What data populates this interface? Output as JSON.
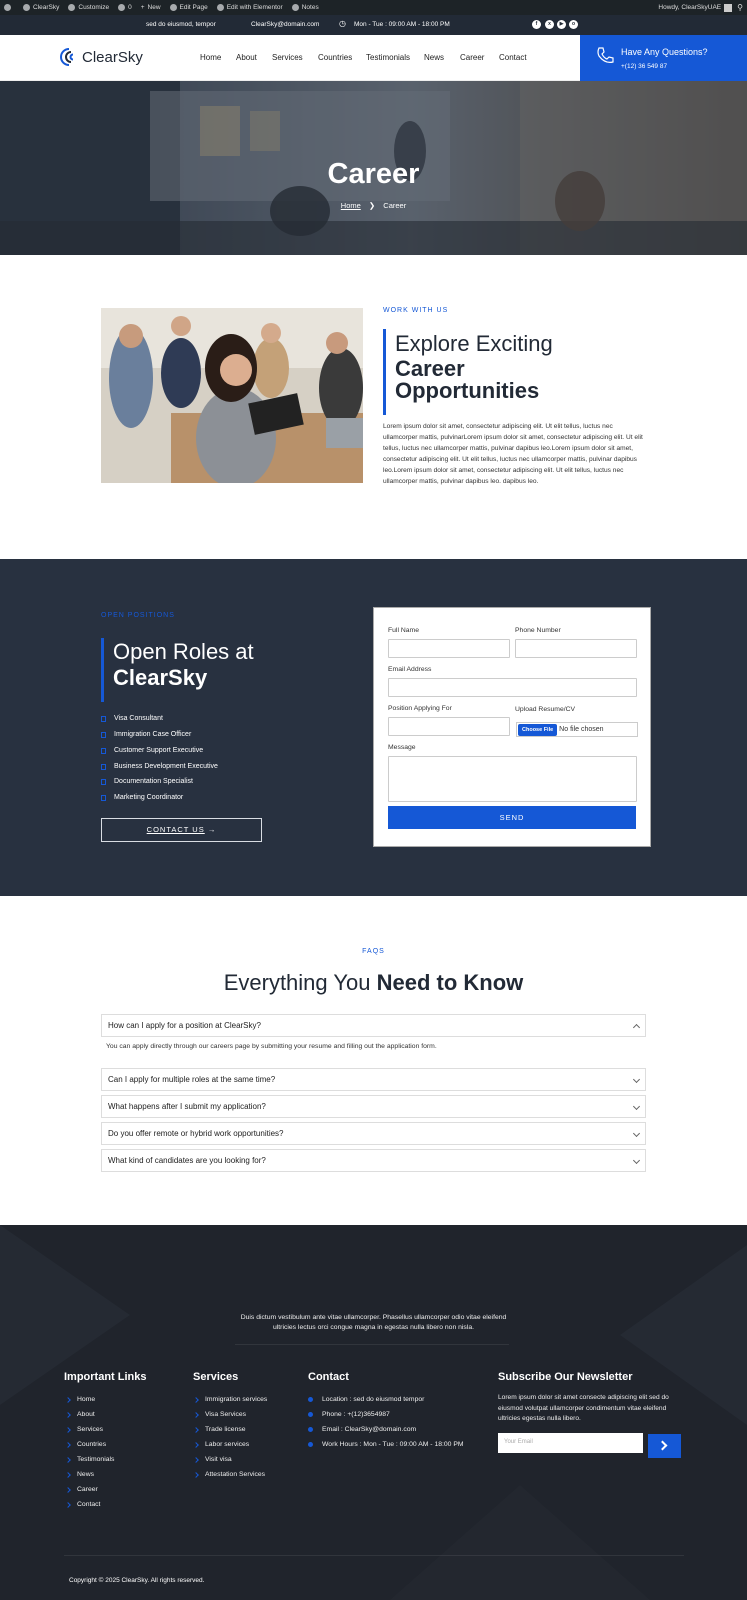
{
  "wpbar": {
    "items": [
      "ClearSky",
      "Customize",
      "0",
      "New",
      "Edit Page",
      "Edit with Elementor",
      "Notes"
    ],
    "greeting": "Howdy, ClearSkyUAE"
  },
  "topinfo": {
    "address": "sed do eiusmod, tempor",
    "email": "ClearSky@domain.com",
    "hours": "Mon - Tue : 09:00 AM - 18:00 PM",
    "social_icons": [
      "facebook-icon",
      "x-icon",
      "youtube-icon",
      "instagram-icon"
    ]
  },
  "header": {
    "logo_text": "ClearSky",
    "nav": [
      "Home",
      "About",
      "Services",
      "Countries",
      "Testimonials",
      "News",
      "Career",
      "Contact"
    ],
    "cta_title": "Have Any Questions?",
    "cta_phone": "+(12) 36 549 87",
    "accent": "#1558d6"
  },
  "hero": {
    "title": "Career",
    "crumb_home": "Home",
    "crumb_current": "Career"
  },
  "about": {
    "label": "WORK WITH US",
    "heading_light": "Explore Exciting",
    "heading_bold_1": "Career",
    "heading_bold_2": "Opportunities",
    "paragraph": "Lorem ipsum dolor sit amet, consectetur adipiscing elit. Ut elit tellus, luctus nec ullamcorper mattis, pulvinarLorem ipsum dolor sit amet, consectetur adipiscing elit. Ut elit tellus, luctus nec ullamcorper mattis, pulvinar dapibus leo.Lorem ipsum dolor sit amet, consectetur adipiscing elit. Ut elit tellus, luctus nec ullamcorper mattis, pulvinar dapibus leo.Lorem ipsum dolor sit amet, consectetur adipiscing elit. Ut elit tellus, luctus nec ullamcorper mattis, pulvinar dapibus leo. dapibus leo."
  },
  "open_positions": {
    "label": "OPEN POSITIONS",
    "heading_light": "Open Roles at",
    "heading_bold": "ClearSky",
    "roles": [
      "Visa Consultant",
      "Immigration Case Officer",
      "Customer Support Executive",
      "Business Development Executive",
      "Documentation Specialist",
      "Marketing Coordinator"
    ],
    "contact_button": "CONTACT US"
  },
  "form": {
    "full_name_label": "Full Name",
    "phone_label": "Phone Number",
    "email_label": "Email Address",
    "position_label": "Position Applying For",
    "resume_label": "Upload Resume/CV",
    "choose_file": "Choose File",
    "no_file": "No file chosen",
    "message_label": "Message",
    "send_button": "SEND"
  },
  "faqs": {
    "label": "FAQS",
    "title_light": "Everything You",
    "title_bold": "Need to Know",
    "items": [
      {
        "q": "How can I apply for a position at ClearSky?",
        "a": "You can apply directly through our careers page by submitting your resume and filling out the application form.",
        "open": true
      },
      {
        "q": "Can I apply for multiple roles at the same time?",
        "open": false
      },
      {
        "q": "What happens after I submit my application?",
        "open": false
      },
      {
        "q": "Do you offer remote or hybrid work opportunities?",
        "open": false
      },
      {
        "q": "What kind of candidates are you looking for?",
        "open": false
      }
    ]
  },
  "footer": {
    "tagline_1": "Duis dictum vestibulum ante vitae ullamcorper. Phasellus ullamcorper odio vitae eleifend",
    "tagline_2": "ultricies lectus orci congue magna in egestas nulla libero non nisla.",
    "important_title": "Important Links",
    "important_links": [
      "Home",
      "About",
      "Services",
      "Countries",
      "Testimonials",
      "News",
      "Career",
      "Contact"
    ],
    "services_title": "Services",
    "services_links": [
      "Immigration services",
      "Visa Services",
      "Trade license",
      "Labor services",
      "Visit visa",
      "Attestation Services"
    ],
    "contact_title": "Contact",
    "contact_items": [
      "Location : sed do eiusmod tempor",
      "Phone : +(12)3654987",
      "Email : ClearSky@domain.com",
      "Work Hours : Mon - Tue : 09:00 AM - 18:00 PM"
    ],
    "newsletter_title": "Subscribe Our Newsletter",
    "newsletter_text": "Lorem ipsum dolor sit amet consecte adipiscing elit sed do eiusmod volutpat ullamcorper condimentum vitae eleifend ultricies egestas nulla libero.",
    "email_placeholder": "Your Email",
    "copyright": "Copyright © 2025 ClearSky. All rights reserved."
  }
}
